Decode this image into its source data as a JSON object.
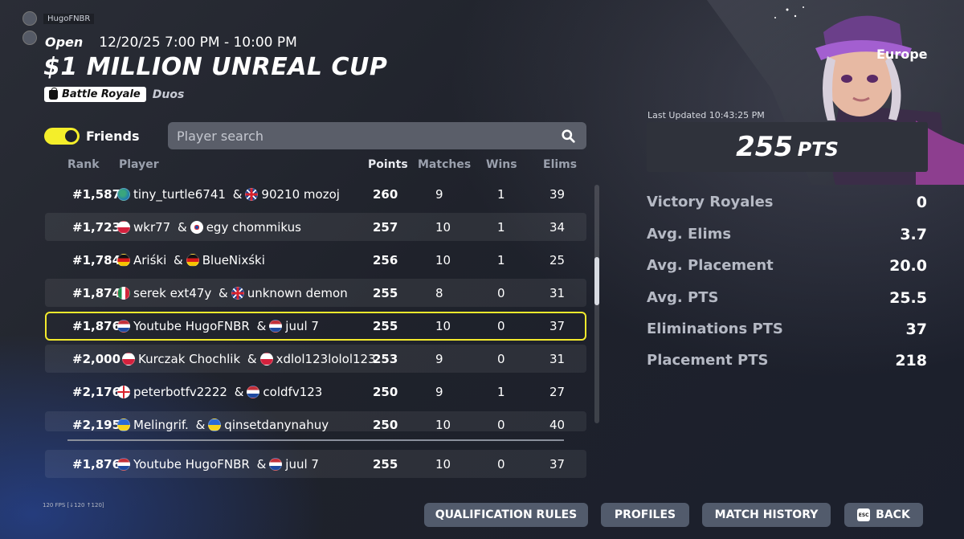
{
  "top_users": [
    "HugoFNBR",
    ""
  ],
  "header": {
    "mode": "Open",
    "time_range": "12/20/25 7:00 PM - 10:00 PM",
    "title": "$1 MILLION UNREAL CUP",
    "tag": "Battle Royale",
    "team_size": "Duos"
  },
  "filters": {
    "friends_label": "Friends",
    "friends_on": true,
    "search_placeholder": "Player search"
  },
  "columns": {
    "rank": "Rank",
    "player": "Player",
    "points": "Points",
    "matches": "Matches",
    "wins": "Wins",
    "elims": "Elims"
  },
  "rows": [
    {
      "rank": "#1,587",
      "p1": "tiny_turtle6741",
      "f1": "earth",
      "p2": "90210 mozoj",
      "f2": "gb",
      "points": "260",
      "matches": "9",
      "wins": "1",
      "elims": "39"
    },
    {
      "rank": "#1,723",
      "p1": "wkr77",
      "f1": "pl",
      "p2": "egy chommikus",
      "f2": "kr",
      "points": "257",
      "matches": "10",
      "wins": "1",
      "elims": "34"
    },
    {
      "rank": "#1,784",
      "p1": "Ariśki",
      "f1": "de",
      "p2": "BlueNixśki",
      "f2": "de",
      "points": "256",
      "matches": "10",
      "wins": "1",
      "elims": "25"
    },
    {
      "rank": "#1,874",
      "p1": "serek ext47y",
      "f1": "mx",
      "p2": "unknown demon",
      "f2": "gb",
      "points": "255",
      "matches": "8",
      "wins": "0",
      "elims": "31"
    },
    {
      "rank": "#1,876",
      "p1": "Youtube HugoFNBR",
      "f1": "nl",
      "p2": "juul 7",
      "f2": "nl",
      "points": "255",
      "matches": "10",
      "wins": "0",
      "elims": "37"
    },
    {
      "rank": "#2,000",
      "p1": "Kurczak Chochlik",
      "f1": "pl",
      "p2": "xdlol123lolol123",
      "f2": "pl",
      "points": "253",
      "matches": "9",
      "wins": "0",
      "elims": "31"
    },
    {
      "rank": "#2,176",
      "p1": "peterbotfv2222",
      "f1": "en",
      "p2": "coldfv123",
      "f2": "nl",
      "points": "250",
      "matches": "9",
      "wins": "1",
      "elims": "27"
    },
    {
      "rank": "#2,195",
      "p1": "Melingrif.",
      "f1": "ua",
      "p2": "qinsetdanynahuy",
      "f2": "ua",
      "points": "250",
      "matches": "10",
      "wins": "0",
      "elims": "40"
    }
  ],
  "my_row": {
    "rank": "#1,876",
    "p1": "Youtube HugoFNBR",
    "f1": "nl",
    "p2": "juul 7",
    "f2": "nl",
    "points": "255",
    "matches": "10",
    "wins": "0",
    "elims": "37"
  },
  "summary": {
    "region": "Europe",
    "last_updated": "Last Updated 10:43:25 PM",
    "points": "255",
    "points_unit": "PTS",
    "stats": [
      {
        "label": "Victory Royales",
        "value": "0"
      },
      {
        "label": "Avg. Elims",
        "value": "3.7"
      },
      {
        "label": "Avg. Placement",
        "value": "20.0"
      },
      {
        "label": "Avg. PTS",
        "value": "25.5"
      },
      {
        "label": "Eliminations PTS",
        "value": "37"
      },
      {
        "label": "Placement PTS",
        "value": "218"
      }
    ]
  },
  "buttons": {
    "qualification": "QUALIFICATION RULES",
    "profiles": "PROFILES",
    "history": "MATCH HISTORY",
    "back": "BACK",
    "esc": "ESC"
  },
  "fps": "120 FPS [↓120 ↑120]",
  "colors": {
    "accent": "#f3ea2c",
    "button": "#525b6c"
  }
}
